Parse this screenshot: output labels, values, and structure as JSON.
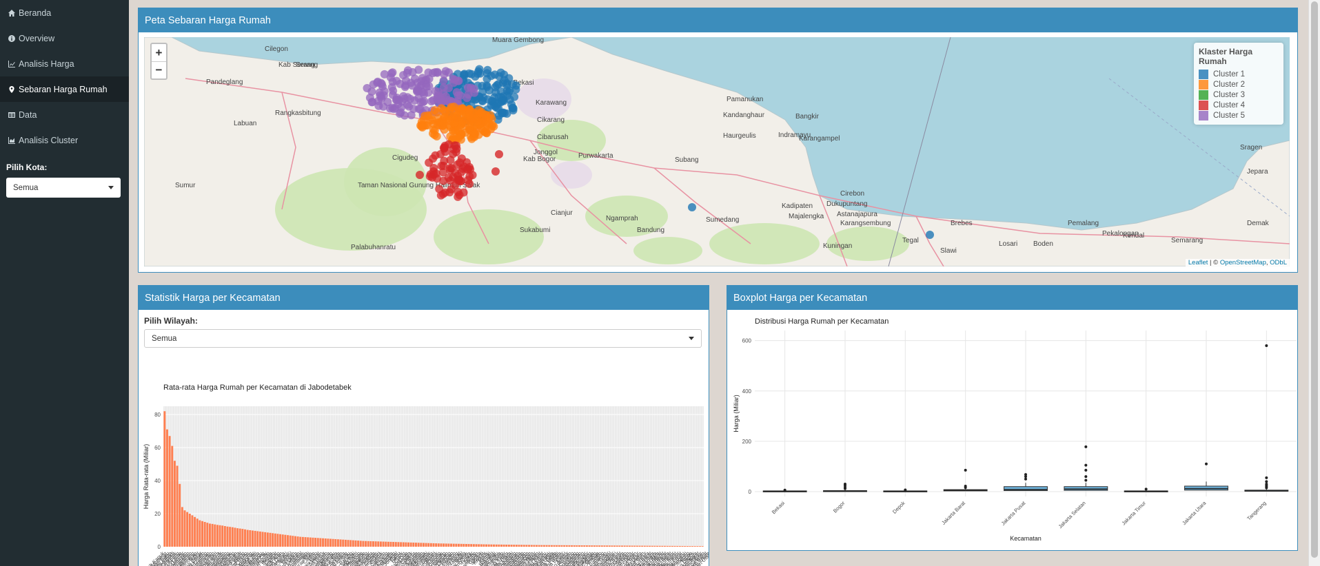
{
  "sidebar": {
    "items": [
      {
        "label": "Beranda",
        "icon": "home-icon"
      },
      {
        "label": "Overview",
        "icon": "info-icon"
      },
      {
        "label": "Analisis Harga",
        "icon": "line-chart-icon"
      },
      {
        "label": "Sebaran Harga Rumah",
        "icon": "map-marker-icon"
      },
      {
        "label": "Data",
        "icon": "table-icon"
      },
      {
        "label": "Analisis Cluster",
        "icon": "area-chart-icon"
      }
    ],
    "active_index": 3,
    "city_label": "Pilih Kota:",
    "city_value": "Semua"
  },
  "map_panel": {
    "title": "Peta Sebaran Harga Rumah",
    "zoom_in": "+",
    "zoom_out": "−",
    "legend_title": "Klaster Harga Rumah",
    "clusters": [
      {
        "name": "Cluster 1",
        "color": "#1f77b4"
      },
      {
        "name": "Cluster 2",
        "color": "#ff7f0e"
      },
      {
        "name": "Cluster 3",
        "color": "#2ca02c"
      },
      {
        "name": "Cluster 4",
        "color": "#d62728"
      },
      {
        "name": "Cluster 5",
        "color": "#9467bd"
      }
    ],
    "attribution": {
      "leaflet": "Leaflet",
      "sep": " | © ",
      "osm": "OpenStreetMap",
      "odbl": "ODbL"
    },
    "places": [
      "Cilegon",
      "Serang",
      "Pandeglang",
      "Rangkasbitung",
      "Labuan",
      "Cigudeg",
      "Kab Serang",
      "Muara Gembong",
      "Karawang",
      "Kab Bekasi",
      "Cikarang",
      "Cibarusah",
      "Jonggol",
      "Kab Bogor",
      "Purwakarta",
      "Subang",
      "Pamanukan",
      "Indramayu",
      "Kandanghaur",
      "Haurgeulis",
      "Karangampel",
      "Bangkir",
      "Cianjur",
      "Sukabumi",
      "Bandung",
      "Cirebon",
      "Kadipaten",
      "Majalengka",
      "Dukupuntang",
      "Brebes",
      "Pemalang",
      "Pekalongan",
      "Kendal",
      "Semarang",
      "Jepara",
      "Demak",
      "Sumedang",
      "Ngamprah",
      "Kuningan",
      "Tegal",
      "Palabuhanratu",
      "Sumur",
      "Taman Nasional Gunung Halimun Salak",
      "Astanajapura",
      "Karangsembung",
      "Slawi",
      "Losari",
      "Boden",
      "Sragen"
    ]
  },
  "bar_panel": {
    "title": "Statistik Harga per Kecamatan",
    "region_label": "Pilih Wilayah:",
    "region_value": "Semua",
    "chart_data": {
      "type": "bar",
      "title": "Rata-rata Harga Rumah per Kecamatan di Jabodetabek",
      "xlabel": "",
      "ylabel": "Harga Rata-rata (Miliar)",
      "ylim": [
        0,
        85
      ],
      "yticks": [
        0,
        20,
        40,
        60,
        80
      ],
      "bar_color": "#ff7f50",
      "categories": [
        "Pantai Indah Kapuk",
        "Menteng",
        "Kebayoran Baru",
        "Pondok Indah",
        "Setiabudi",
        "Cilandak",
        "Tanah Abang",
        "Kebayoran Lama",
        "Gambir",
        "Senayan",
        "Mampang Prapatan",
        "Pesanggrahan",
        "Kemang",
        "Pancoran",
        "Tebet",
        "Sawah Besar",
        "Cempaka Putih",
        "Kelapa Gading",
        "Pademangan",
        "Penjaringan",
        "Grogol Petamburan",
        "Taman Sari",
        "Tambora",
        "Kebon Jeruk",
        "Palmerah",
        "Kembangan",
        "Cengkareng",
        "Kalideres",
        "Pulo Gadung",
        "Matraman",
        "Jatinegara",
        "Duren Sawit",
        "Cakung",
        "Pasar Rebo",
        "Ciracas",
        "Cipayung",
        "Makasar",
        "Kramat Jati",
        "Jagakarsa",
        "Pasar Minggu",
        "Serpong",
        "BSD City",
        "Gading Serpong",
        "Alam Sutera",
        "Bintaro",
        "Ciputat",
        "Pamulang",
        "Pondok Aren",
        "Serpong Utara",
        "Karawaci",
        "Cibubur",
        "Sentul",
        "Bogor Tengah",
        "Bogor Utara",
        "Bogor Selatan",
        "Tanah Sareal",
        "Cimanggis",
        "Sawangan",
        "Beji",
        "Pancoran Mas",
        "Cinere",
        "Limo",
        "Bekasi Barat",
        "Bekasi Selatan",
        "Bekasi Timur",
        "Jatiasih",
        "Jatisampurna",
        "Bantargebang",
        "Rawalumbu",
        "Medan Satria",
        "Mustika Jaya",
        "Tambun Selatan",
        "Cikarang Utara",
        "Cibitung",
        "Setu",
        "Parung",
        "Cileungsi",
        "Gunung Putri",
        "Citeureup",
        "Cibinong",
        "Bojonggede",
        "Tajurhalang",
        "Kemang Bogor",
        "Ciampea",
        "Dramaga",
        "Ciomas",
        "Tamansari",
        "Cijeruk",
        "Caringin",
        "Megamendung",
        "Cisarua",
        "Sukaraja",
        "Babakan Madang",
        "Jonggol",
        "Cariu",
        "Legok",
        "Curug",
        "Kelapa Dua",
        "Pagedangan",
        "Cisauk",
        "Tigaraksa",
        "Cikupa",
        "Balaraja",
        "Sepatan",
        "Teluknaga",
        "Kosambi",
        "Batuceper",
        "Benda",
        "Neglasari",
        "Periuk",
        "Jatiuwung",
        "Cibodas",
        "Tangerang",
        "Larangan",
        "Ciledug",
        "Karang Tengah",
        "Cipondoh",
        "Pinang",
        "Serpong Barat",
        "Setu Tangsel",
        "Rajeg",
        "Pasar Kemis",
        "Sindang Jaya",
        "Solear",
        "Jambe",
        "Panongan",
        "Cisoka",
        "Jayanti",
        "Kresek",
        "Mauk",
        "Kemiri",
        "Sukadiri",
        "Pakuhaji",
        "Mekar Baru",
        "Sukamulya",
        "Kronjo",
        "Gunung Kaler",
        "Kresek Utara",
        "Sukamulya Utara",
        "Sukatani",
        "Tambelang",
        "Babelan",
        "Tarumajaya",
        "Muara Gembong",
        "Cabangbungin",
        "Pebayuran",
        "Kedungwaringin",
        "Karangbahagia",
        "Cikarang Timur",
        "Cikarang Selatan",
        "Cikarang Pusat",
        "Cikarang Barat",
        "Serang Baru",
        "Bojongmangu",
        "Sukawangi",
        "Tambun Utara",
        "Pondok Gede",
        "Pondok Melati",
        "Bekasi Utara",
        "Cisarua Bogor",
        "Ciawi",
        "Gunung Sindur",
        "Rumpin",
        "Ciseeng",
        "Leuwiliang",
        "Leuwisadeng",
        "Pamijahan",
        "Cibungbulang",
        "Rancabungur",
        "Ranca Bungur",
        "Nanggung",
        "Sukajaya",
        "Cigudeg",
        "Jasinga",
        "Tenjo",
        "Parung Panjang",
        "Cigombong",
        "Ciawi Timur",
        "Klapanunggal",
        "Sukamakmur",
        "Tanjungsari",
        "Sukaraja Timur",
        "Cijeruk Barat",
        "Ciseeng Utara",
        "Kemang Selatan",
        "Parung Selatan",
        "Cileungsi Utara",
        "Gunung Putri Timur",
        "Citeureup Selatan",
        "Cibinong Timur",
        "Babakan Madang Utara",
        "Sukamakmur Selatan",
        "Jonggol Timur",
        "Cariu Utara",
        "Tanjungsari Barat",
        "Ciampea Utara",
        "Tenjolaya",
        "Cibungbulang Utara",
        "Pamijahan Barat",
        "Leuwiliang Barat",
        "Rumpin Barat",
        "Jasinga Utara",
        "Tenjo Barat",
        "Parung Panjang Timur",
        "Gunung Sindur Barat",
        "Bojonggede Timur",
        "Tajurhalang Barat",
        "Sawangan Baru",
        "Bojongsari",
        "Cilodong",
        "Tapos",
        "Cipayung Depok",
        "Sukmajaya",
        "Cimanggis Barat",
        "Beji Timur",
        "Limo Selatan",
        "Cinere Barat",
        "Pancoran Mas Utara",
        "Bojongsari Utara"
      ],
      "values_note": "top-ranked then long tail",
      "values": [
        82,
        71,
        67,
        61,
        52,
        49,
        38,
        24,
        22,
        21,
        20,
        19,
        18,
        17,
        16,
        15.5,
        15,
        14.5,
        14,
        13.8,
        13.5,
        13.2,
        13,
        12.8,
        12.5,
        12.2,
        12,
        11.8,
        11.5,
        11.2,
        11,
        10.8,
        10.5,
        10.2,
        10,
        9.8,
        9.6,
        9.4,
        9.2,
        9,
        8.8,
        8.6,
        8.4,
        8.2,
        8,
        7.8,
        7.6,
        7.4,
        7.2,
        7,
        6.8,
        6.6,
        6.4,
        6.2,
        6,
        5.9,
        5.8,
        5.7,
        5.6,
        5.5,
        5.4,
        5.3,
        5.2,
        5.1,
        5,
        4.9,
        4.8,
        4.7,
        4.6,
        4.5,
        4.4,
        4.3,
        4.2,
        4.1,
        4,
        3.9,
        3.8,
        3.7,
        3.6,
        3.5,
        3.45,
        3.4,
        3.35,
        3.3,
        3.25,
        3.2,
        3.15,
        3.1,
        3.05,
        3,
        2.95,
        2.9,
        2.85,
        2.8,
        2.75,
        2.7,
        2.65,
        2.6,
        2.55,
        2.5,
        2.45,
        2.4,
        2.35,
        2.3,
        2.25,
        2.2,
        2.15,
        2.1,
        2.05,
        2,
        1.97,
        1.94,
        1.91,
        1.88,
        1.85,
        1.82,
        1.79,
        1.76,
        1.73,
        1.7,
        1.67,
        1.64,
        1.61,
        1.58,
        1.55,
        1.52,
        1.49,
        1.46,
        1.43,
        1.4,
        1.38,
        1.36,
        1.34,
        1.32,
        1.3,
        1.28,
        1.26,
        1.24,
        1.22,
        1.2,
        1.18,
        1.16,
        1.14,
        1.12,
        1.1,
        1.08,
        1.06,
        1.04,
        1.02,
        1,
        0.99,
        0.98,
        0.97,
        0.96,
        0.95,
        0.94,
        0.93,
        0.92,
        0.91,
        0.9,
        0.89,
        0.88,
        0.87,
        0.86,
        0.85,
        0.84,
        0.83,
        0.82,
        0.81,
        0.8,
        0.79,
        0.78,
        0.77,
        0.76,
        0.75,
        0.74,
        0.73,
        0.72,
        0.71,
        0.7,
        0.69,
        0.68,
        0.67,
        0.66,
        0.65,
        0.64,
        0.63,
        0.62,
        0.61,
        0.6,
        0.59,
        0.58,
        0.57,
        0.56,
        0.55,
        0.54,
        0.53,
        0.52,
        0.51,
        0.5,
        0.49,
        0.48,
        0.47,
        0.46,
        0.45,
        0.44,
        0.43,
        0.42,
        0.41,
        0.4,
        0.39,
        0.38,
        0.37,
        0.36,
        0.35
      ]
    }
  },
  "box_panel": {
    "title": "Boxplot Harga per Kecamatan",
    "chart_data": {
      "type": "boxplot",
      "title": "Distribusi Harga Rumah per Kecamatan",
      "xlabel": "Kecamatan",
      "ylabel": "Harga (Miliar)",
      "ylim": [
        0,
        600
      ],
      "yticks": [
        0,
        200,
        400,
        600
      ],
      "fill_color": "#6baed6",
      "categories": [
        "Bekasi",
        "Bogor",
        "Depok",
        "Jakarta Barat",
        "Jakarta Pusat",
        "Jakarta Selatan",
        "Jakarta Timur",
        "Jakarta Utara",
        "Tangerang"
      ],
      "boxes": [
        {
          "q1": 1,
          "median": 2,
          "q3": 3,
          "whisker_high": 5,
          "outliers": [
            6
          ]
        },
        {
          "q1": 1.5,
          "median": 2.5,
          "q3": 4,
          "whisker_high": 8,
          "outliers": [
            12,
            18,
            25,
            30
          ]
        },
        {
          "q1": 1,
          "median": 2,
          "q3": 3,
          "whisker_high": 5,
          "outliers": [
            7
          ]
        },
        {
          "q1": 3,
          "median": 5,
          "q3": 8,
          "whisker_high": 14,
          "outliers": [
            16,
            22,
            85
          ]
        },
        {
          "q1": 4,
          "median": 8,
          "q3": 20,
          "whisker_high": 35,
          "outliers": [
            50,
            60,
            68
          ]
        },
        {
          "q1": 5,
          "median": 10,
          "q3": 20,
          "whisker_high": 35,
          "outliers": [
            45,
            60,
            85,
            105,
            178
          ]
        },
        {
          "q1": 1,
          "median": 2,
          "q3": 3,
          "whisker_high": 5,
          "outliers": [
            10
          ]
        },
        {
          "q1": 6,
          "median": 12,
          "q3": 22,
          "whisker_high": 40,
          "outliers": [
            110
          ]
        },
        {
          "q1": 2,
          "median": 3,
          "q3": 6,
          "whisker_high": 10,
          "outliers": [
            15,
            20,
            25,
            30,
            40,
            55,
            580
          ]
        }
      ]
    }
  }
}
